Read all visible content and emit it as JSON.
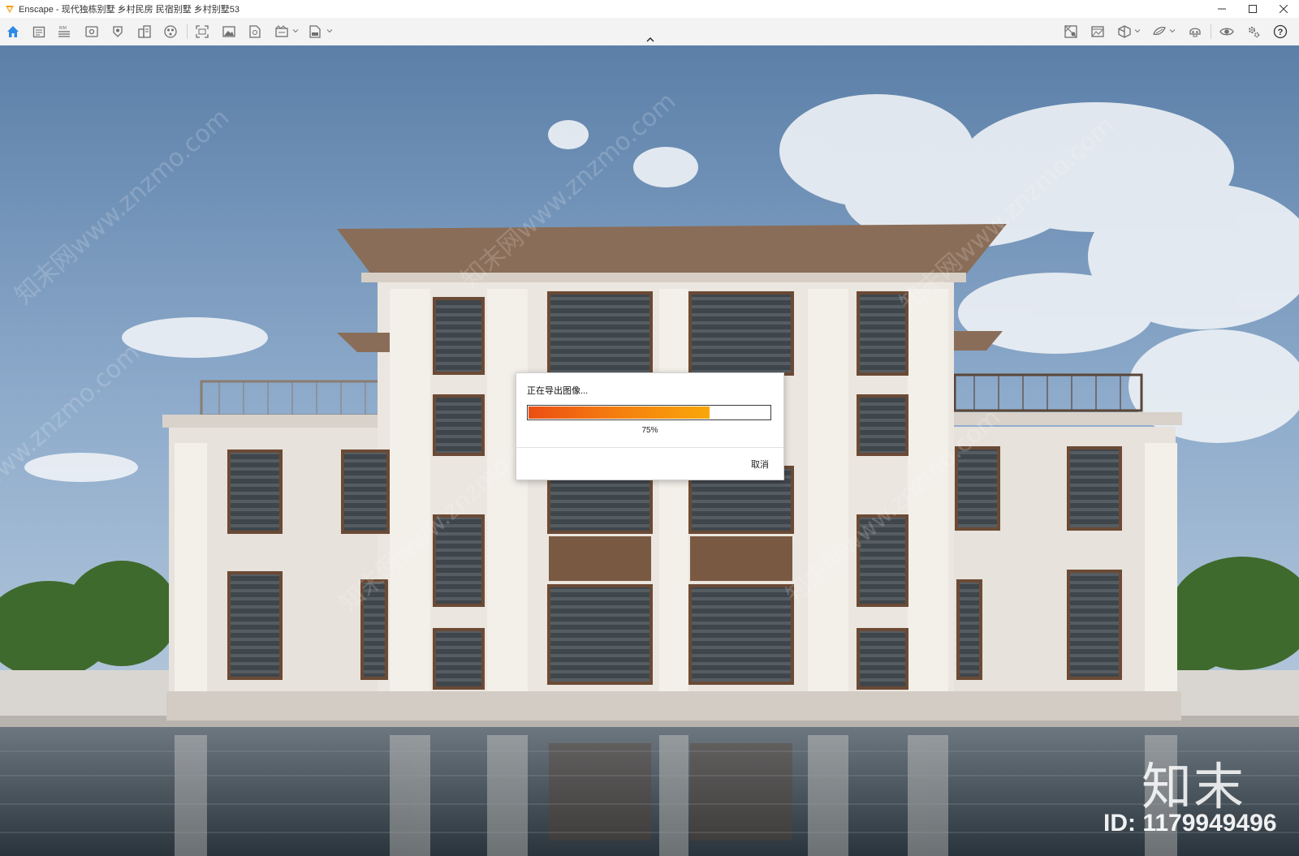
{
  "window": {
    "app_name": "Enscape",
    "title": "Enscape - 现代独栋别墅 乡村民房 民宿别墅 乡村别墅53",
    "controls": [
      "minimize",
      "maximize",
      "close"
    ]
  },
  "toolbar": {
    "left_icons": [
      "home-icon",
      "notes-icon",
      "bim-icon",
      "view-icon",
      "walk-icon",
      "asset-library-icon",
      "material-icon",
      "screenshot-icon",
      "image-icon",
      "panorama-icon",
      "video-export-icon",
      "exe-export-icon"
    ],
    "bim_badge": "BIM",
    "right_icons": [
      "site-context-icon",
      "batch-render-icon",
      "cube-view-icon",
      "light-view-icon",
      "vr-headset-icon",
      "visual-settings-icon",
      "general-settings-icon",
      "help-icon"
    ],
    "help_glyph": "?"
  },
  "dialog": {
    "title": "正在导出图像...",
    "progress": 0.75,
    "progress_label": "75%",
    "cancel_label": "取消"
  },
  "watermark": {
    "brand": "知末",
    "id_text": "ID: 1179949496",
    "diagonal_text": "知末网www.znzmo.com"
  },
  "colors": {
    "accent_orange": "#f47b0f",
    "progress_start": "#ec4e13",
    "progress_end": "#f9a70a",
    "toolbar_icon": "#6f6f6f",
    "home_icon": "#2d8ae6"
  }
}
